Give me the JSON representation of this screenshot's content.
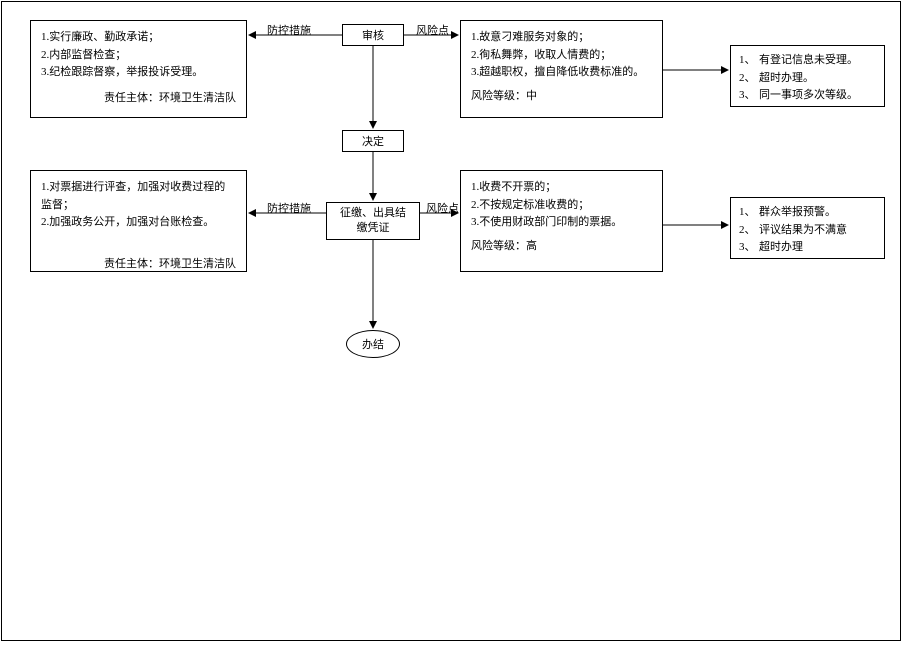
{
  "nodes": {
    "audit": "审核",
    "decide": "决定",
    "collect_line1": "征缴、出具结",
    "collect_line2": "缴凭证",
    "done": "办结"
  },
  "labels": {
    "prevent": "防控措施",
    "risk": "风险点"
  },
  "top_left": {
    "l1": "1.实行廉政、勤政承诺；",
    "l2": "2.内部监督检查；",
    "l3": "3.纪检跟踪督察，举报投诉受理。",
    "resp": "责任主体：环境卫生清洁队"
  },
  "top_mid": {
    "l1": "1.故意刁难服务对象的；",
    "l2": "2.徇私舞弊，收取人情费的；",
    "l3": "3.超越职权，擅自降低收费标准的。",
    "risk": "风险等级：中"
  },
  "top_right": {
    "i1n": "1、",
    "i1": "有登记信息未受理。",
    "i2n": "2、",
    "i2": "超时办理。",
    "i3n": "3、",
    "i3": "同一事项多次等级。"
  },
  "bot_left": {
    "l1": "1.对票据进行评查，加强对收费过程的监督；",
    "l2": "2.加强政务公开，加强对台账检查。",
    "resp": "责任主体：环境卫生清洁队"
  },
  "bot_mid": {
    "l1": "1.收费不开票的；",
    "l2": "2.不按规定标准收费的；",
    "l3": "3.不使用财政部门印制的票据。",
    "risk": "风险等级：高"
  },
  "bot_right": {
    "i1n": "1、",
    "i1": "群众举报预警。",
    "i2n": "2、",
    "i2": "评议结果为不满意",
    "i3n": "3、",
    "i3": "超时办理"
  }
}
